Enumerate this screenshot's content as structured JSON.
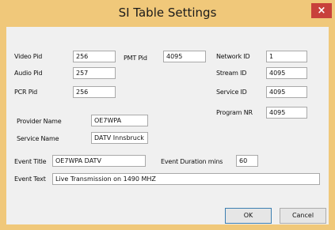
{
  "window": {
    "title": "SI Table Settings",
    "close_glyph": "×",
    "title_bar_color": "#f0c87a",
    "close_color": "#c8413b"
  },
  "fields": {
    "video_pid": {
      "label": "Video Pid",
      "value": "256"
    },
    "audio_pid": {
      "label": "Audio Pid",
      "value": "257"
    },
    "pcr_pid": {
      "label": "PCR Pid",
      "value": "256"
    },
    "pmt_pid": {
      "label": "PMT Pid",
      "value": "4095"
    },
    "network_id": {
      "label": "Network ID",
      "value": "1"
    },
    "stream_id": {
      "label": "Stream ID",
      "value": "4095"
    },
    "service_id": {
      "label": "Service ID",
      "value": "4095"
    },
    "program_nr": {
      "label": "Program NR",
      "value": "4095"
    },
    "provider_name": {
      "label": "Provider Name",
      "value": "OE7WPA"
    },
    "service_name": {
      "label": "Service Name",
      "value": "DATV Innsbruck"
    },
    "event_title": {
      "label": "Event Title",
      "value": "OE7WPA DATV"
    },
    "event_duration": {
      "label": "Event Duration mins",
      "value": "60"
    },
    "event_text": {
      "label": "Event Text",
      "value": "Live Transmission on 1490 MHZ"
    }
  },
  "buttons": {
    "ok": "OK",
    "cancel": "Cancel"
  }
}
